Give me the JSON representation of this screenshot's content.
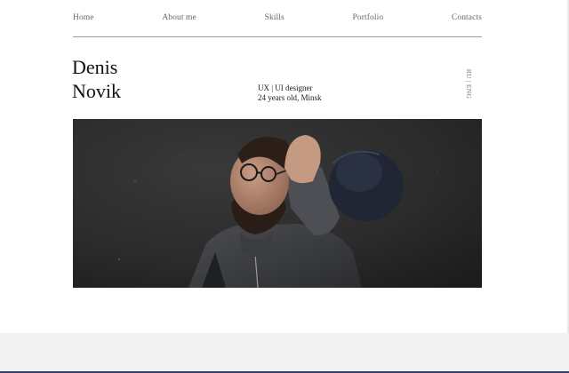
{
  "nav": {
    "items": [
      {
        "label": "Home"
      },
      {
        "label": "About me"
      },
      {
        "label": "Skills"
      },
      {
        "label": "Portfolio"
      },
      {
        "label": "Contacts"
      }
    ]
  },
  "hero": {
    "first_name": "Denis",
    "last_name": "Novik",
    "role": "UX | UI designer",
    "details": "24 years old, Minsk",
    "language_switch": "RU | ENG"
  },
  "photo": {
    "description_icon": "portrait-photo"
  },
  "colors": {
    "nav_text": "#666666",
    "divider": "#9a9a9a",
    "photo_background": "#2a2a2b",
    "footer_band": "#f2f2f2",
    "bottom_strip": "#3b3f70"
  }
}
